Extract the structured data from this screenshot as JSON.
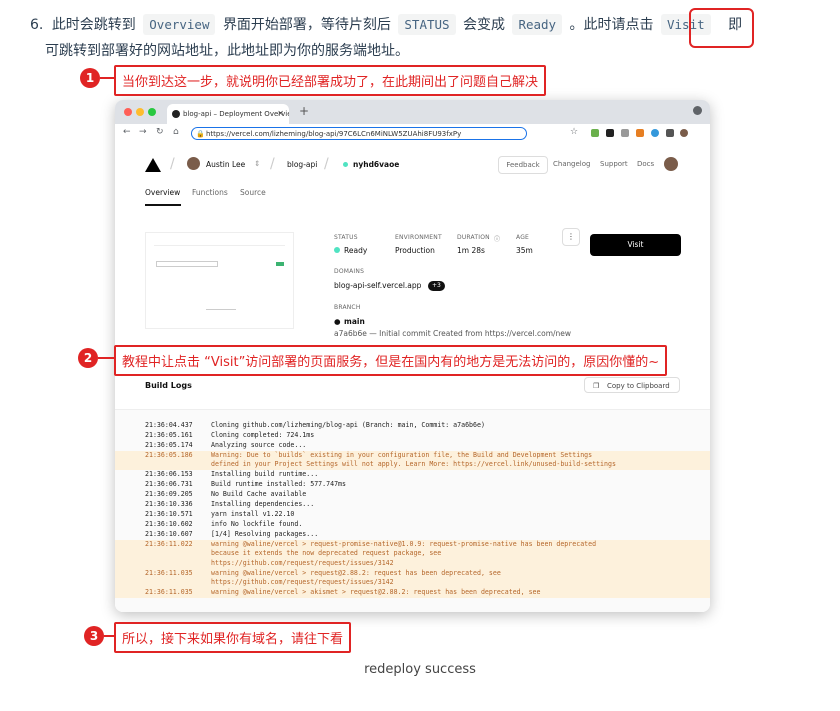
{
  "step": {
    "number": "6.",
    "text1": "此时会跳转到",
    "code1": "Overview",
    "text2": "界面开始部署，等待片刻后",
    "code2": "STATUS",
    "text3": "会变成",
    "code3": "Ready",
    "text4": "。此时请点击",
    "code4": "Visit",
    "text5": "即",
    "line2": "可跳转到部署好的网站地址，此地址即为你的服务端地址。"
  },
  "annotations": [
    {
      "badge": "1",
      "text": "当你到达这一步，就说明你已经部署成功了，在此期间出了问题自己解决"
    },
    {
      "badge": "2",
      "text": "教程中让点击 “Visit”访问部署的页面服务，但是在国内有的地方是无法访问的，原因你懂的~"
    },
    {
      "badge": "3",
      "text": "所以，接下来如果你有域名，请往下看"
    }
  ],
  "browser": {
    "tab_title": "blog-api – Deployment Overvie",
    "url": "https://vercel.com/lizheming/blog-api/97C6LCn6MiNLW5ZUAhi8FU93fxPy"
  },
  "vercel": {
    "user": "Austin Lee",
    "project": "blog-api",
    "deployment": "nyhd6vaoe",
    "feedback": "Feedback",
    "nav": [
      "Changelog",
      "Support",
      "Docs"
    ],
    "tabs": [
      "Overview",
      "Functions",
      "Source"
    ],
    "status_label": "STATUS",
    "status_value": "Ready",
    "env_label": "ENVIRONMENT",
    "env_value": "Production",
    "duration_label": "DURATION",
    "duration_value": "1m 28s",
    "age_label": "AGE",
    "age_value": "35m",
    "visit": "Visit",
    "domains_label": "DOMAINS",
    "domain_value": "blog-api-self.vercel.app",
    "domain_more": "+3",
    "branch_label": "BRANCH",
    "branch_value": "main",
    "commit": "a7a6b6e — Initial commit Created from https://vercel.com/new",
    "build_logs": "Build Logs",
    "copy": "Copy to Clipboard"
  },
  "logs": [
    {
      "ts": "21:36:04.437",
      "msg": "Cloning github.com/lizheming/blog-api (Branch: main, Commit: a7a6b6e)",
      "warn": false
    },
    {
      "ts": "21:36:05.161",
      "msg": "Cloning completed: 724.1ms",
      "warn": false
    },
    {
      "ts": "21:36:05.174",
      "msg": "Analyzing source code...",
      "warn": false
    },
    {
      "ts": "21:36:05.186",
      "msg": "Warning: Due to `builds` existing in your configuration file, the Build and Development Settings\ndefined in your Project Settings will not apply. Learn More: https://vercel.link/unused-build-settings",
      "warn": true
    },
    {
      "ts": "21:36:06.153",
      "msg": "Installing build runtime...",
      "warn": false
    },
    {
      "ts": "21:36:06.731",
      "msg": "Build runtime installed: 577.747ms",
      "warn": false
    },
    {
      "ts": "21:36:09.205",
      "msg": "No Build Cache available",
      "warn": false
    },
    {
      "ts": "21:36:10.336",
      "msg": "Installing dependencies...",
      "warn": false
    },
    {
      "ts": "21:36:10.571",
      "msg": "yarn install v1.22.10",
      "warn": false
    },
    {
      "ts": "21:36:10.602",
      "msg": "info No lockfile found.",
      "warn": false
    },
    {
      "ts": "21:36:10.607",
      "msg": "[1/4] Resolving packages...",
      "warn": false
    },
    {
      "ts": "21:36:11.022",
      "msg": "warning @waline/vercel > request-promise-native@1.0.9: request-promise-native has been deprecated\nbecause it extends the now deprecated request package, see\nhttps://github.com/request/request/issues/3142",
      "warn": true
    },
    {
      "ts": "21:36:11.035",
      "msg": "warning @waline/vercel > request@2.88.2: request has been deprecated, see\nhttps://github.com/request/request/issues/3142",
      "warn": true
    },
    {
      "ts": "21:36:11.035",
      "msg": "warning @waline/vercel > akismet > request@2.88.2: request has been deprecated, see",
      "warn": true
    }
  ],
  "caption": "redeploy success"
}
